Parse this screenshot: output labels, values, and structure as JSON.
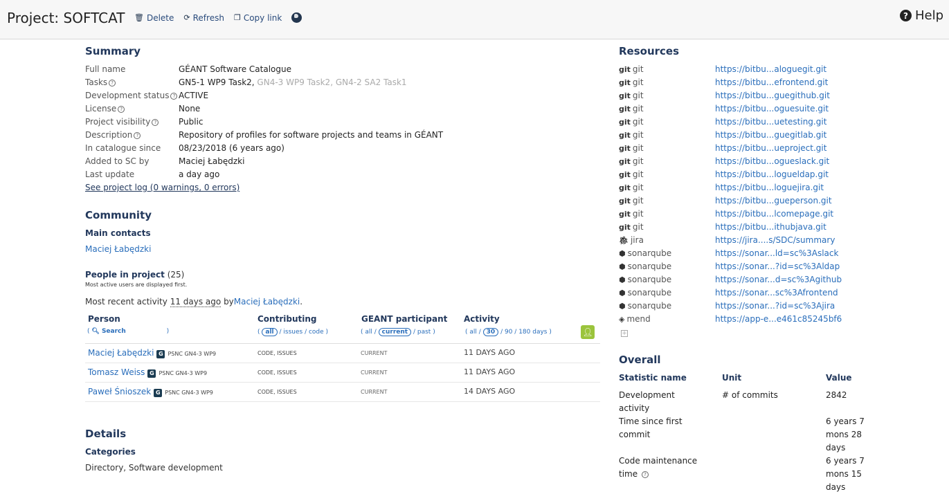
{
  "header": {
    "title": "Project: SOFTCAT",
    "delete_label": "Delete",
    "refresh_label": "Refresh",
    "copy_label": "Copy link",
    "help_label": "Help"
  },
  "summary": {
    "heading": "Summary",
    "rows": [
      {
        "k": "Full name",
        "v": "GÉANT Software Catalogue"
      },
      {
        "k": "Tasks",
        "v": "GN5-1 WP9 Task2,",
        "v2": "GN4-3 WP9 Task2, GN4-2 SA2 Task1"
      },
      {
        "k": "Development status",
        "v": "ACTIVE"
      },
      {
        "k": "License",
        "v": "None"
      },
      {
        "k": "Project visibility",
        "v": "Public"
      },
      {
        "k": "Description",
        "v": "Repository of profiles for software projects and teams in GÉANT"
      },
      {
        "k": "In catalogue since",
        "v": "08/23/2018 (6 years ago)"
      },
      {
        "k": "Added to SC by",
        "v": "Maciej Łabędzki"
      },
      {
        "k": "Last update",
        "v": "a day ago"
      }
    ],
    "log_link": "See project log (0 warnings, 0 errors)"
  },
  "community": {
    "heading": "Community",
    "main_contacts": "Main contacts",
    "contact": "Maciej Łabędzki",
    "people_heading": "People in project",
    "people_count": "(25)",
    "people_note": "Most active users are displayed first.",
    "recent_prefix": "Most recent activity",
    "recent_when": "11 days ago",
    "recent_by": "by",
    "recent_user": "Maciej Łabędzki",
    "recent_suffix": "."
  },
  "people_table": {
    "headers": [
      "Person",
      "Contributing",
      "GEANT participant",
      "Activity"
    ],
    "search_label": "Search",
    "contrib_filters": [
      "all",
      "issues",
      "code"
    ],
    "geant_filters": [
      "all",
      "current",
      "past"
    ],
    "activity_filters": [
      "all",
      "30",
      "90",
      "180 days"
    ],
    "rows": [
      {
        "name": "Maciej Łabędzki",
        "badge": "G",
        "org": "PSNC GN4-3 WP9",
        "contrib": "CODE, ISSUES",
        "geant": "CURRENT",
        "activity": "11 days ago"
      },
      {
        "name": "Tomasz Weiss",
        "badge": "G",
        "org": "PSNC GN4-3 WP9",
        "contrib": "CODE, ISSUES",
        "geant": "CURRENT",
        "activity": "11 days ago"
      },
      {
        "name": "Paweł Śnioszek",
        "badge": "G",
        "org": "PSNC GN4-3 WP9",
        "contrib": "CODE, ISSUES",
        "geant": "CURRENT",
        "activity": "14 days ago"
      }
    ]
  },
  "details": {
    "heading": "Details",
    "categories_heading": "Categories",
    "categories": "Directory, Software development"
  },
  "resources": {
    "heading": "Resources",
    "rows": [
      {
        "icon": "git",
        "type": "git",
        "url": "https://bitbu...aloguegit.git"
      },
      {
        "icon": "git",
        "type": "git",
        "url": "https://bitbu...efrontend.git"
      },
      {
        "icon": "git",
        "type": "git",
        "url": "https://bitbu...guegithub.git"
      },
      {
        "icon": "git",
        "type": "git",
        "url": "https://bitbu...oguesuite.git"
      },
      {
        "icon": "git",
        "type": "git",
        "url": "https://bitbu...uetesting.git"
      },
      {
        "icon": "git",
        "type": "git",
        "url": "https://bitbu...guegitlab.git"
      },
      {
        "icon": "git",
        "type": "git",
        "url": "https://bitbu...ueproject.git"
      },
      {
        "icon": "git",
        "type": "git",
        "url": "https://bitbu...ogueslack.git"
      },
      {
        "icon": "git",
        "type": "git",
        "url": "https://bitbu...logueldap.git"
      },
      {
        "icon": "git",
        "type": "git",
        "url": "https://bitbu...loguejira.git"
      },
      {
        "icon": "git",
        "type": "git",
        "url": "https://bitbu...gueperson.git"
      },
      {
        "icon": "git",
        "type": "git",
        "url": "https://bitbu...lcomepage.git"
      },
      {
        "icon": "git",
        "type": "git",
        "url": "https://bitbu...ithubjava.git"
      },
      {
        "icon": "bug",
        "type": "jira",
        "url": "https://jira....s/SDC/summary"
      },
      {
        "icon": "cube",
        "type": "sonarqube",
        "url": "https://sonar...ld=sc%3Aslack"
      },
      {
        "icon": "cube",
        "type": "sonarqube",
        "url": "https://sonar...?id=sc%3Aldap"
      },
      {
        "icon": "cube",
        "type": "sonarqube",
        "url": "https://sonar...d=sc%3Agithub"
      },
      {
        "icon": "cube",
        "type": "sonarqube",
        "url": "https://sonar...sc%3Afrontend"
      },
      {
        "icon": "cube",
        "type": "sonarqube",
        "url": "https://sonar...?id=sc%3Ajira"
      },
      {
        "icon": "diamond",
        "type": "mend",
        "url": "https://app-e...e461c85245bf6"
      }
    ]
  },
  "overall": {
    "heading": "Overall",
    "headers": [
      "Statistic name",
      "Unit",
      "Value"
    ],
    "rows": [
      {
        "name1": "Development",
        "name2": "activity",
        "unit": "# of commits",
        "v1": "2842"
      },
      {
        "name1": "Time since first",
        "name2": "commit",
        "unit": "",
        "v1": "6 years 7",
        "v2": "mons 28",
        "v3": "days"
      },
      {
        "name1": "Code maintenance",
        "name2": "time",
        "unit": "",
        "v1": "6 years 7",
        "v2": "mons 15",
        "v3": "days"
      }
    ]
  }
}
